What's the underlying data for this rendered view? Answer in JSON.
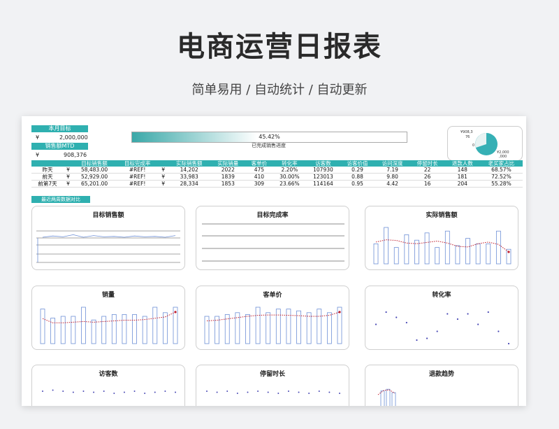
{
  "page": {
    "title": "电商运营日报表",
    "subtitle": "简单易用  /  自动统计  /  自动更新"
  },
  "summary": {
    "month_target_label": "本月目标",
    "month_target_currency": "¥",
    "month_target_value": "2,000,000",
    "mtd_label": "销售额MTD",
    "mtd_currency": "¥",
    "mtd_value": "908,376",
    "progress_text": "45.42%",
    "progress_value": 0.4542,
    "progress_caption": "已完成销售进度",
    "pie_labels": {
      "top": "¥908,3",
      "top2": "76",
      "left": "0",
      "right": "¥2,000",
      "right2": ",000"
    }
  },
  "table": {
    "headers": [
      "",
      "",
      "目标销售额",
      "目标完成率",
      "",
      "实际销售额",
      "实际销量",
      "客单价",
      "转化率",
      "访客数",
      "访客价值",
      "访问深度",
      "停留时长",
      "退款人数",
      "老买家占比"
    ],
    "rows": [
      [
        "昨天",
        "¥",
        "58,483.00",
        "#REF!",
        "¥",
        "14,202",
        "2022",
        "475",
        "2.20%",
        "107930",
        "0.29",
        "7.19",
        "22",
        "148",
        "68.57%"
      ],
      [
        "前天",
        "¥",
        "52,929.00",
        "#REF!",
        "¥",
        "33,983",
        "1839",
        "410",
        "30.00%",
        "123013",
        "0.88",
        "9.80",
        "26",
        "181",
        "72.52%"
      ],
      [
        "前第7天",
        "¥",
        "65,201.00",
        "#REF!",
        "¥",
        "28,334",
        "1853",
        "309",
        "23.66%",
        "114164",
        "0.95",
        "4.42",
        "16",
        "204",
        "55.28%"
      ]
    ]
  },
  "section_label": "最近两周数据对比",
  "cards": [
    {
      "title": "目标销售额",
      "kind": "target_line",
      "line": [
        0.5,
        0.35,
        0.45,
        0.2,
        0.5,
        0.3,
        0.45,
        0.4,
        0.5,
        0.35,
        0.45,
        0.4,
        0.5,
        0.3
      ]
    },
    {
      "title": "目标完成率",
      "kind": "empty_lines"
    },
    {
      "title": "实际销售额",
      "kind": "bars_trend",
      "bars": [
        0.55,
        1.0,
        0.45,
        0.8,
        0.65,
        0.85,
        0.45,
        0.9,
        0.5,
        0.7,
        0.55,
        0.55,
        0.9,
        0.4
      ],
      "trend": [
        0.75,
        0.82,
        0.8,
        0.72,
        0.7,
        0.74,
        0.78,
        0.72,
        0.62,
        0.6,
        0.7,
        0.75,
        0.68,
        0.45
      ]
    },
    {
      "title": "销量",
      "kind": "bars_trend",
      "bars": [
        0.95,
        0.7,
        0.75,
        0.75,
        1.0,
        0.65,
        0.75,
        0.8,
        0.8,
        0.8,
        0.75,
        1.0,
        0.85,
        1.0
      ],
      "trend": [
        0.85,
        0.72,
        0.72,
        0.74,
        0.76,
        0.74,
        0.76,
        0.78,
        0.8,
        0.8,
        0.82,
        0.86,
        0.9,
        1.05
      ]
    },
    {
      "title": "客单价",
      "kind": "bars_trend",
      "bars": [
        0.75,
        0.75,
        0.8,
        0.85,
        0.8,
        1.0,
        0.85,
        0.95,
        0.95,
        0.9,
        0.85,
        0.95,
        0.85,
        1.0
      ],
      "trend": [
        0.78,
        0.8,
        0.84,
        0.88,
        0.92,
        0.95,
        0.96,
        0.96,
        0.95,
        0.94,
        0.92,
        0.92,
        0.95,
        1.05
      ]
    },
    {
      "title": "转化率",
      "kind": "scatter",
      "points": [
        0.55,
        0.9,
        0.75,
        0.6,
        0.1,
        0.15,
        0.35,
        0.85,
        0.7,
        0.85,
        0.55,
        0.9,
        0.35,
        0.0
      ]
    },
    {
      "title": "访客数",
      "kind": "scatter_partial",
      "points": [
        0.6,
        0.65,
        0.6,
        0.55,
        0.6,
        0.55,
        0.6,
        0.5,
        0.55,
        0.6,
        0.5,
        0.55,
        0.6,
        0.55
      ]
    },
    {
      "title": "停留时长",
      "kind": "scatter_partial",
      "points": [
        0.6,
        0.55,
        0.6,
        0.5,
        0.55,
        0.6,
        0.55,
        0.5,
        0.6,
        0.55,
        0.5,
        0.6,
        0.55,
        0.5
      ]
    },
    {
      "title": "退款趋势",
      "kind": "partial_bars",
      "bars": [
        0.7,
        0.9,
        0.5
      ]
    }
  ],
  "colors": {
    "teal": "#2fb0b0",
    "bar": "#6d8fd6",
    "trend": "#c0202f",
    "point": "#4a4ab5",
    "grid": "#555555"
  }
}
